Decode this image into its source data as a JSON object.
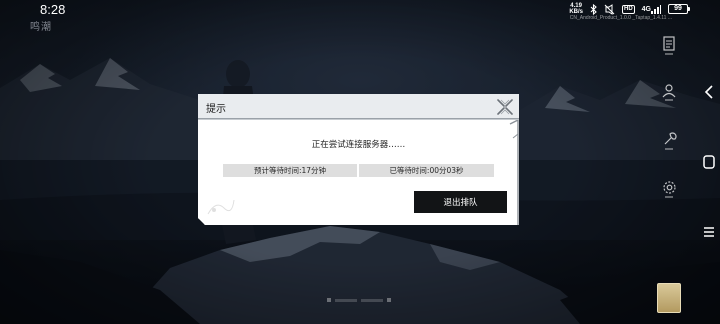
{
  "status_bar": {
    "time": "8:28",
    "net_speed": "4.19",
    "net_unit": "KB/s",
    "hd_label": "HD",
    "signal_label": "4G",
    "battery": "99",
    "build_info": "CN_Android_Product_1.0.0 _Taptap_1.4.11 ..."
  },
  "game": {
    "logo_text": "鸣潮"
  },
  "dialog": {
    "title": "提示",
    "message": "正在尝试连接服务器……",
    "estimated_wait": "预计等待时间:17分钟",
    "waited_time": "已等待时间:00分03秒",
    "leave_queue_label": "退出排队"
  },
  "icons": {
    "close": "close-x-icon",
    "back": "nav-back-icon",
    "home": "nav-home-icon",
    "recent": "nav-recent-icon"
  },
  "colors": {
    "dialog_bg": "#ffffff",
    "header_bg": "#e9ecef",
    "info_bg": "#dedede",
    "button_bg": "#121416",
    "button_text": "#ffffff"
  }
}
